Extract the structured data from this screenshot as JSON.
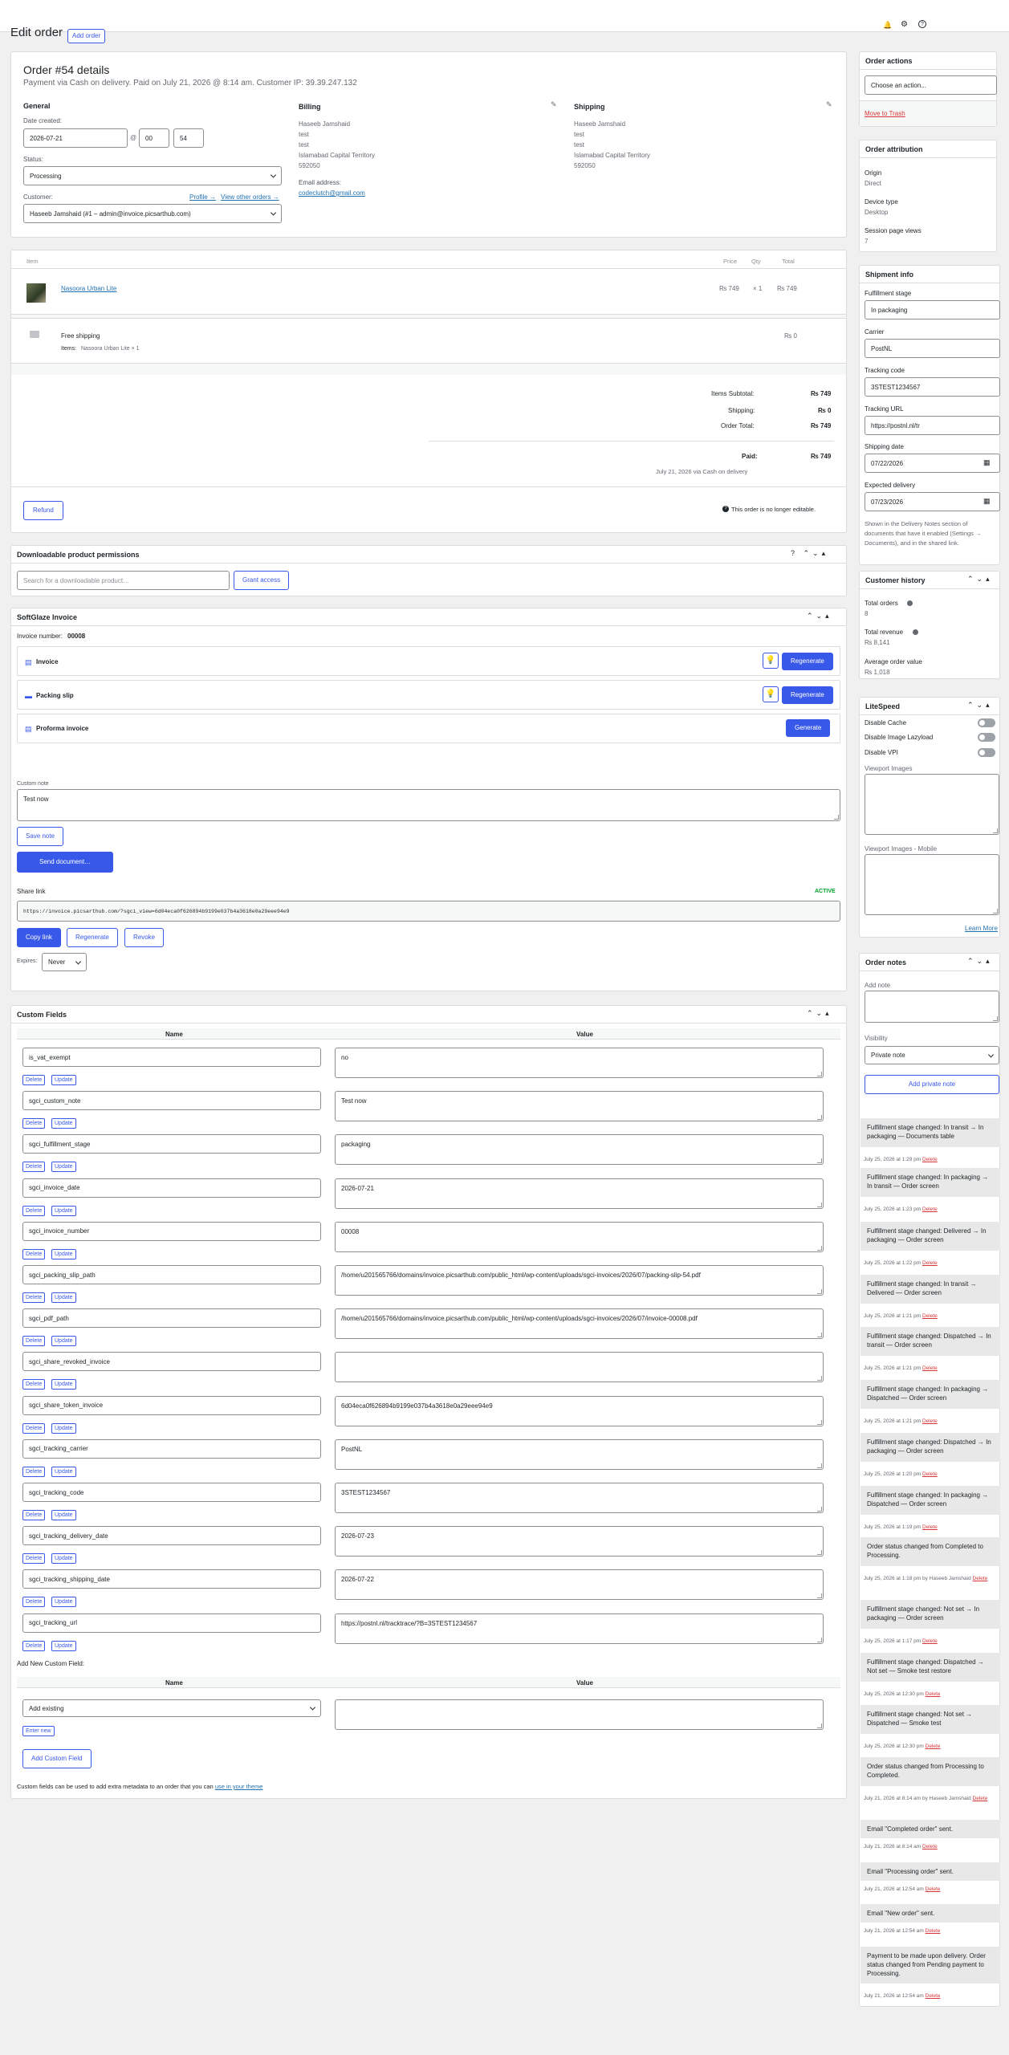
{
  "page": {
    "title": "Edit order",
    "add_order": "Add order"
  },
  "topbar": {
    "icons": [
      "bell-icon",
      "gear-icon",
      "help-icon"
    ]
  },
  "order": {
    "title": "Order #54 details",
    "meta": "Payment via Cash on delivery. Paid on July 21, 2026 @ 8:14 am. Customer IP: 39.39.247.132",
    "general_heading": "General",
    "date_label": "Date created:",
    "date": "2026-07-21",
    "at": "@",
    "hour": "00",
    "minute": "54",
    "status_label": "Status:",
    "status": "Processing",
    "customer_label": "Customer:",
    "profile_link": "Profile →",
    "other_orders_link": "View other orders →",
    "customer": "Haseeb Jamshaid (#1 – admin@invoice.picsarthub.com)",
    "billing_heading": "Billing",
    "billing_lines": [
      "Haseeb Jamshaid",
      "test",
      "test",
      "Islamabad Capital Territory",
      "592050"
    ],
    "email_label": "Email address:",
    "email": "codeclutch@gmail.com",
    "shipping_heading": "Shipping",
    "shipping_lines": [
      "Haseeb Jamshaid",
      "test",
      "test",
      "Islamabad Capital Territory",
      "592050"
    ]
  },
  "items": {
    "col_item": "Item",
    "col_price": "Price",
    "col_qty": "Qty",
    "col_total": "Total",
    "product_name": "Nasoora Urban Lite",
    "product_price": "₨ 749",
    "product_qty": "× 1",
    "product_total": "₨ 749",
    "shipping_name": "Free shipping",
    "shipping_items_label": "Items:",
    "shipping_items": "Nasoora Urban Lite × 1",
    "shipping_total": "₨ 0",
    "subtotal_label": "Items Subtotal:",
    "subtotal": "₨ 749",
    "shipping_label": "Shipping:",
    "shipping": "₨ 0",
    "order_total_label": "Order Total:",
    "order_total": "₨ 749",
    "paid_label": "Paid:",
    "paid": "₨ 749",
    "paid_note": "July 21, 2026 via Cash on delivery",
    "refund": "Refund",
    "not_editable": "This order is no longer editable."
  },
  "downloads": {
    "title": "Downloadable product permissions",
    "search_placeholder": "Search for a downloadable product…",
    "grant": "Grant access"
  },
  "invoice": {
    "title": "SoftGlaze Invoice",
    "number_label": "Invoice number:",
    "number": "00008",
    "docs": [
      {
        "name": "Invoice",
        "action": "Regenerate"
      },
      {
        "name": "Packing slip",
        "action": "Regenerate"
      },
      {
        "name": "Proforma invoice",
        "action": "Generate"
      }
    ],
    "note_label": "Custom note",
    "note": "Test now",
    "save_note": "Save note",
    "send": "Send document…",
    "share_label": "Share link",
    "share_status": "ACTIVE",
    "share_url": "https://invoice.picsarthub.com/?sgci_view=6d04eca0f626894b9199e037b4a3618e0a29eee94e9",
    "copy": "Copy link",
    "regenerate": "Regenerate",
    "revoke": "Revoke",
    "expires_label": "Expires:",
    "expires": "Never"
  },
  "custom_fields": {
    "title": "Custom Fields",
    "col_name": "Name",
    "col_value": "Value",
    "delete": "Delete",
    "update": "Update",
    "rows": [
      {
        "name": "is_vat_exempt",
        "value": "no"
      },
      {
        "name": "sgci_custom_note",
        "value": "Test now"
      },
      {
        "name": "sgci_fulfillment_stage",
        "value": "packaging"
      },
      {
        "name": "sgci_invoice_date",
        "value": "2026-07-21"
      },
      {
        "name": "sgci_invoice_number",
        "value": "00008"
      },
      {
        "name": "sgci_packing_slip_path",
        "value": "/home/u201565766/domains/invoice.picsarthub.com/public_html/wp-content/uploads/sgci-invoices/2026/07/packing-slip-54.pdf"
      },
      {
        "name": "sgci_pdf_path",
        "value": "/home/u201565766/domains/invoice.picsarthub.com/public_html/wp-content/uploads/sgci-invoices/2026/07/invoice-00008.pdf"
      },
      {
        "name": "sgci_share_revoked_invoice",
        "value": ""
      },
      {
        "name": "sgci_share_token_invoice",
        "value": "6d04eca0f626894b9199e037b4a3618e0a29eee94e9"
      },
      {
        "name": "sgci_tracking_carrier",
        "value": "PostNL"
      },
      {
        "name": "sgci_tracking_code",
        "value": "3STEST1234567"
      },
      {
        "name": "sgci_tracking_delivery_date",
        "value": "2026-07-23"
      },
      {
        "name": "sgci_tracking_shipping_date",
        "value": "2026-07-22"
      },
      {
        "name": "sgci_tracking_url",
        "value": "https://postnl.nl/tracktrace/?B=3STEST1234567"
      }
    ],
    "add_new_label": "Add New Custom Field:",
    "add_existing": "Add existing",
    "enter_new": "Enter new",
    "add_button": "Add Custom Field",
    "help_text": "Custom fields can be used to add extra metadata to an order that you can",
    "help_link": "use in your theme"
  },
  "sidebar": {
    "actions": {
      "title": "Order actions",
      "choose": "Choose an action...",
      "trash": "Move to Trash"
    },
    "attribution": {
      "title": "Order attribution",
      "origin_label": "Origin",
      "origin": "Direct",
      "device_label": "Device type",
      "device": "Desktop",
      "views_label": "Session page views",
      "views": "7"
    },
    "shipment": {
      "title": "Shipment info",
      "stage_label": "Fulfillment stage",
      "stage": "In packaging",
      "carrier_label": "Carrier",
      "carrier": "PostNL",
      "code_label": "Tracking code",
      "code": "3STEST1234567",
      "url_label": "Tracking URL",
      "url": "https://postnl.nl/tr",
      "ship_date_label": "Shipping date",
      "ship_date": "07/22/2026",
      "exp_label": "Expected delivery",
      "exp_date": "07/23/2026",
      "help": "Shown in the Delivery Notes section of documents that have it enabled (Settings → Documents), and in the shared link."
    },
    "history": {
      "title": "Customer history",
      "orders_label": "Total orders",
      "orders": "8",
      "revenue_label": "Total revenue",
      "revenue": "₨ 8,141",
      "avg_label": "Average order value",
      "avg": "₨ 1,018"
    },
    "litespeed": {
      "title": "LiteSpeed",
      "toggles": [
        "Disable Cache",
        "Disable Image Lazyload",
        "Disable VPI"
      ],
      "vp_label": "Viewport Images",
      "vpm_label": "Viewport Images - Mobile",
      "learn": "Learn More"
    },
    "notes": {
      "title": "Order notes",
      "add_label": "Add note",
      "visibility_label": "Visibility",
      "visibility": "Private note",
      "add_button": "Add private note",
      "delete": "Delete",
      "items": [
        {
          "text": "Fulfillment stage changed: In transit → In packaging — Documents table",
          "meta": "July 25, 2026 at 1:29 pm"
        },
        {
          "text": "Fulfillment stage changed: In packaging → In transit — Order screen",
          "meta": "July 25, 2026 at 1:23 pm"
        },
        {
          "text": "Fulfillment stage changed: Delivered → In packaging — Order screen",
          "meta": "July 25, 2026 at 1:22 pm"
        },
        {
          "text": "Fulfillment stage changed: In transit → Delivered — Order screen",
          "meta": "July 25, 2026 at 1:21 pm"
        },
        {
          "text": "Fulfillment stage changed: Dispatched → In transit — Order screen",
          "meta": "July 25, 2026 at 1:21 pm"
        },
        {
          "text": "Fulfillment stage changed: In packaging → Dispatched — Order screen",
          "meta": "July 25, 2026 at 1:21 pm"
        },
        {
          "text": "Fulfillment stage changed: Dispatched → In packaging — Order screen",
          "meta": "July 25, 2026 at 1:20 pm"
        },
        {
          "text": "Fulfillment stage changed: In packaging → Dispatched — Order screen",
          "meta": "July 25, 2026 at 1:19 pm"
        },
        {
          "text": "Order status changed from Completed to Processing.",
          "meta": "July 25, 2026 at 1:18 pm by Haseeb Jamshaid"
        },
        {
          "text": "Fulfillment stage changed: Not set → In packaging — Order screen",
          "meta": "July 25, 2026 at 1:17 pm"
        },
        {
          "text": "Fulfillment stage changed: Dispatched → Not set — Smoke test restore",
          "meta": "July 25, 2026 at 12:30 pm"
        },
        {
          "text": "Fulfillment stage changed: Not set → Dispatched — Smoke test",
          "meta": "July 25, 2026 at 12:30 pm"
        },
        {
          "text": "Order status changed from Processing to Completed.",
          "meta": "July 21, 2026 at 8:14 am by Haseeb Jamshaid"
        },
        {
          "text": "Email \"Completed order\" sent.",
          "meta": "July 21, 2026 at 8:14 am"
        },
        {
          "text": "Email \"Processing order\" sent.",
          "meta": "July 21, 2026 at 12:54 am"
        },
        {
          "text": "Email \"New order\" sent.",
          "meta": "July 21, 2026 at 12:54 am"
        },
        {
          "text": "Payment to be made upon delivery. Order status changed from Pending payment to Processing.",
          "meta": "July 21, 2026 at 12:54 am"
        }
      ]
    }
  }
}
